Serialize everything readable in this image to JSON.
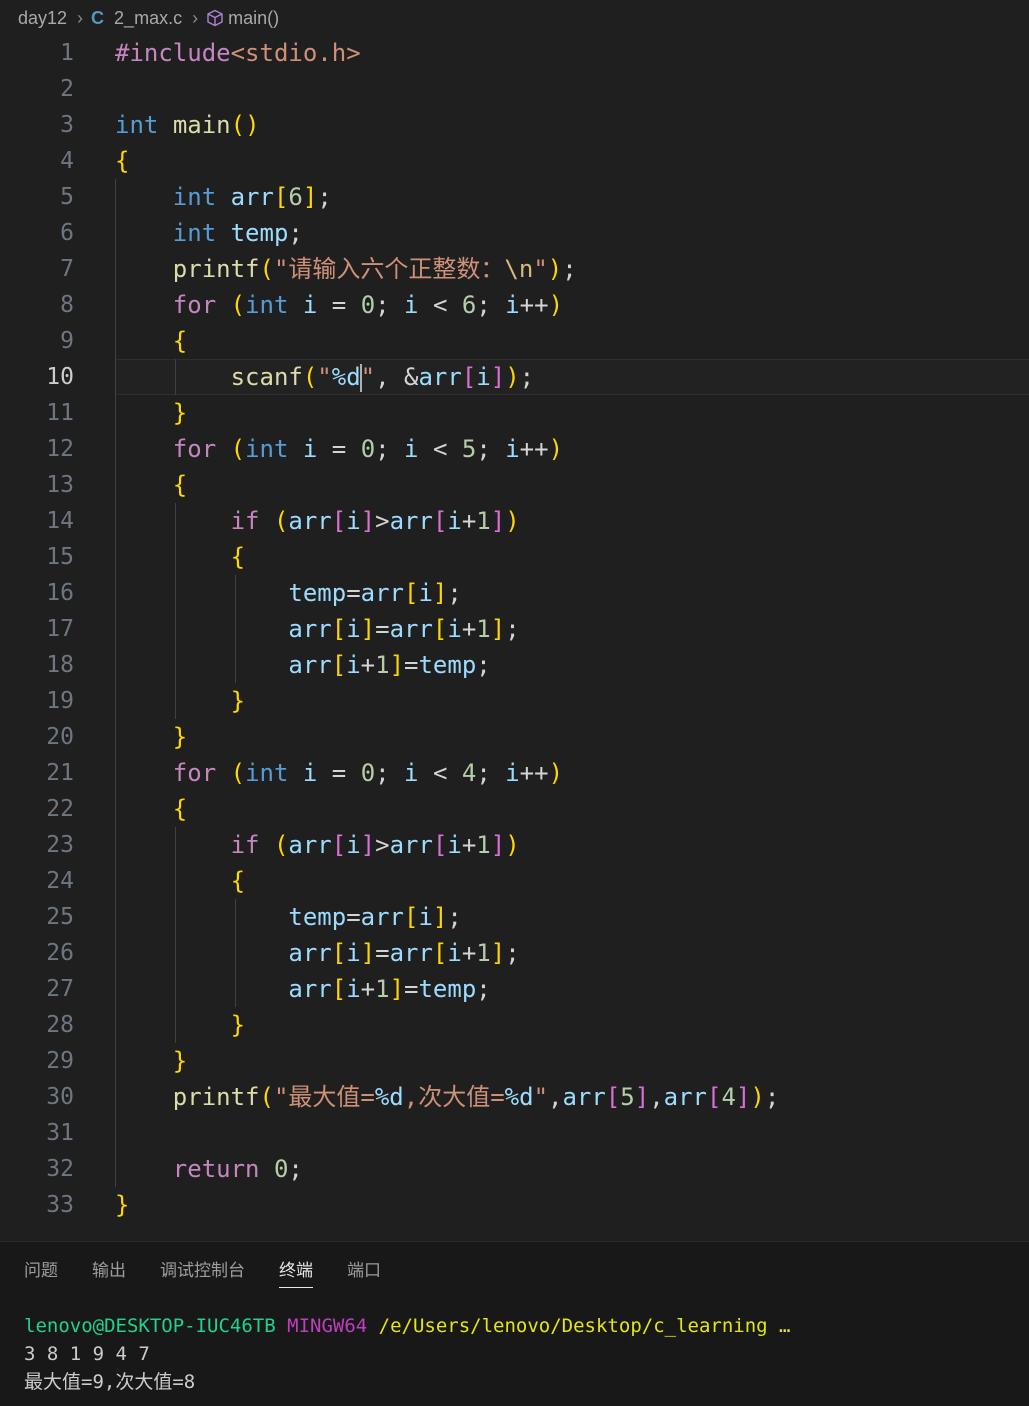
{
  "breadcrumb": {
    "folder": "day12",
    "lang_icon": "C",
    "file": "2_max.c",
    "symbol": "main()",
    "symbol_icon": "cube-icon"
  },
  "editor": {
    "current_line": 10,
    "line_numbers": [
      "1",
      "2",
      "3",
      "4",
      "5",
      "6",
      "7",
      "8",
      "9",
      "10",
      "11",
      "12",
      "13",
      "14",
      "15",
      "16",
      "17",
      "18",
      "19",
      "20",
      "21",
      "22",
      "23",
      "24",
      "25",
      "26",
      "27",
      "28",
      "29",
      "30",
      "31",
      "32",
      "33"
    ],
    "lines": [
      "#include<stdio.h>",
      "",
      "int main()",
      "{",
      "    int arr[6];",
      "    int temp;",
      "    printf(\"请输入六个正整数：\\n\");",
      "    for (int i = 0; i < 6; i++)",
      "    {",
      "        scanf(\"%d\", &arr[i]);",
      "    }",
      "    for (int i = 0; i < 5; i++)",
      "    {",
      "        if (arr[i]>arr[i+1])",
      "        {",
      "            temp=arr[i];",
      "            arr[i]=arr[i+1];",
      "            arr[i+1]=temp;",
      "        }",
      "    }",
      "    for (int i = 0; i < 4; i++)",
      "    {",
      "        if (arr[i]>arr[i+1])",
      "        {",
      "            temp=arr[i];",
      "            arr[i]=arr[i+1];",
      "            arr[i+1]=temp;",
      "        }",
      "    }",
      "    printf(\"最大值=%d,次大值=%d\",arr[5],arr[4]);",
      "",
      "    return 0;",
      "}"
    ]
  },
  "panel": {
    "tabs": [
      "问题",
      "输出",
      "调试控制台",
      "终端",
      "端口"
    ],
    "active_tab": "终端"
  },
  "terminal": {
    "user": "lenovo@DESKTOP-IUC46TB",
    "shell": "MINGW64",
    "path": "/e/Users/lenovo/Desktop/c_learning …",
    "input_line": "3 8 1 9 4 7",
    "output_line": "最大值=9,次大值=8"
  },
  "colors": {
    "background": "#1f1f1f",
    "keyword": "#c586c0",
    "type": "#569cd6",
    "function": "#dcdcaa",
    "string": "#ce9178",
    "number": "#b5cea8",
    "terminal_user": "#23d18b",
    "terminal_host": "#bc3fbc",
    "terminal_path": "#e5e510"
  }
}
